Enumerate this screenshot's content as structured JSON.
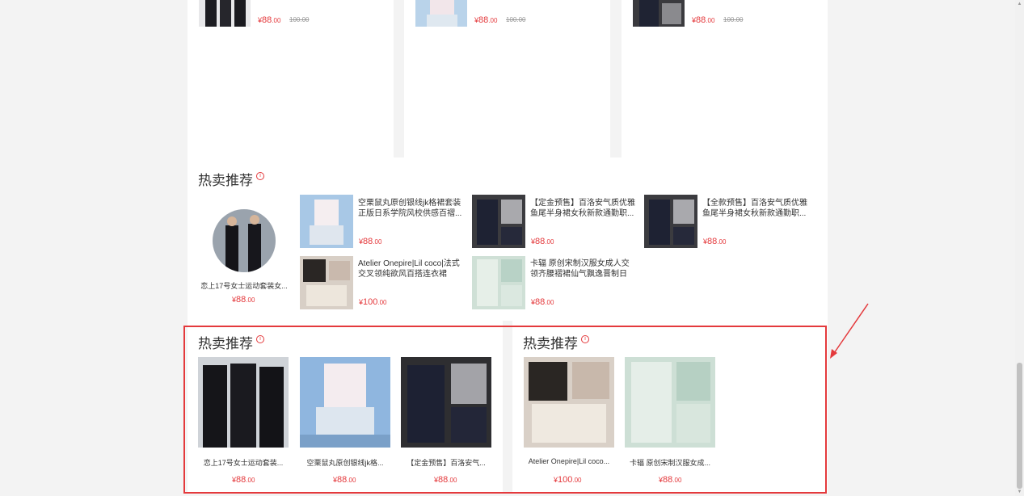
{
  "top_cards": [
    {
      "price": "¥88.00",
      "price_int": "88",
      "price_dec": ".00",
      "old_price": "100.00"
    },
    {
      "price": "¥88.00",
      "price_int": "88",
      "price_dec": ".00",
      "old_price": "100.00"
    },
    {
      "price": "¥88.00",
      "price_int": "88",
      "price_dec": ".00",
      "old_price": "100.00"
    }
  ],
  "currency": "¥",
  "hot_section": {
    "title": "热卖推荐",
    "featured": {
      "title": "恋上17号女士运动套装女...",
      "price_int": "88",
      "price_dec": ".00"
    },
    "items": [
      {
        "title": "空栗鼠丸原创银线jk格裙套装正版日系学院风校供感百褶...",
        "price_int": "88",
        "price_dec": ".00"
      },
      {
        "title": "【定金预售】百洛安气质优雅鱼尾半身裙女秋新款通勤职...",
        "price_int": "88",
        "price_dec": ".00"
      },
      {
        "title": "【全款预售】百洛安气质优雅鱼尾半身裙女秋新款通勤职...",
        "price_int": "88",
        "price_dec": ".00"
      },
      {
        "title": "Atelier Onepire|Lil coco|法式交叉领纯欲风百搭连衣裙Atel...",
        "price_int": "100",
        "price_dec": ".00"
      },
      {
        "title": "卡辐 原创宋制汉服女成人交领齐腰褶裙仙气飘逸晋制日常...",
        "price_int": "88",
        "price_dec": ".00"
      }
    ]
  },
  "bottom_left": {
    "title": "热卖推荐",
    "items": [
      {
        "caption": "恋上17号女士运动套装...",
        "price_int": "88",
        "price_dec": ".00"
      },
      {
        "caption": "空栗鼠丸原创银线jk格...",
        "price_int": "88",
        "price_dec": ".00"
      },
      {
        "caption": "【定金预售】百洛安气...",
        "price_int": "88",
        "price_dec": ".00"
      }
    ]
  },
  "bottom_right": {
    "title": "热卖推荐",
    "items": [
      {
        "caption": "Atelier Onepire|Lil coco...",
        "price_int": "100",
        "price_dec": ".00"
      },
      {
        "caption": "卡辐 原创宋制汉服女成...",
        "price_int": "88",
        "price_dec": ".00"
      }
    ]
  },
  "info_glyph": "i",
  "colors": {
    "accent": "#e4393c",
    "background": "#f3f3f3",
    "panel": "#ffffff"
  }
}
